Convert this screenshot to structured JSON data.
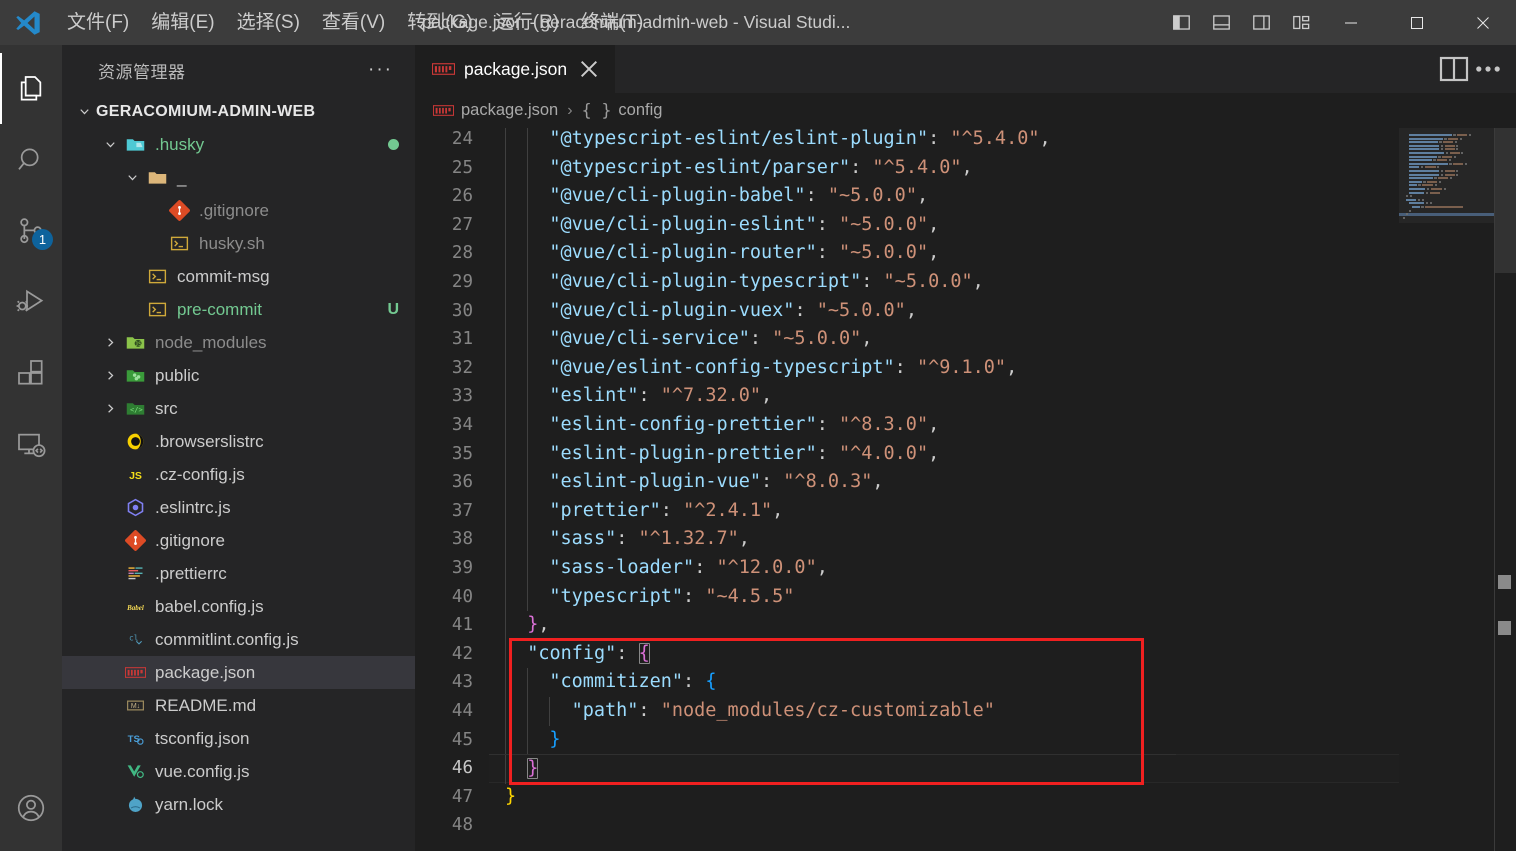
{
  "titlebar": {
    "logo_icon": "vscode-logo-icon",
    "menus": [
      {
        "label": "文件(F)",
        "name": "menu-file"
      },
      {
        "label": "编辑(E)",
        "name": "menu-edit"
      },
      {
        "label": "选择(S)",
        "name": "menu-selection"
      },
      {
        "label": "查看(V)",
        "name": "menu-view"
      },
      {
        "label": "转到(G)",
        "name": "menu-go"
      },
      {
        "label": "运行(R)",
        "name": "menu-run"
      },
      {
        "label": "终端(T)",
        "name": "menu-terminal"
      }
    ],
    "more_label": "···",
    "window_title": "package.json - geracomium-admin-web - Visual Studi...",
    "layout_buttons": [
      {
        "name": "toggle-primary-sidebar-icon"
      },
      {
        "name": "toggle-panel-icon"
      },
      {
        "name": "toggle-secondary-sidebar-icon"
      },
      {
        "name": "customize-layout-icon"
      }
    ],
    "window_buttons": [
      {
        "name": "minimize-button"
      },
      {
        "name": "maximize-button"
      },
      {
        "name": "close-button"
      }
    ]
  },
  "activitybar": {
    "items": [
      {
        "name": "activity-explorer",
        "icon": "files-icon",
        "active": true,
        "badge": ""
      },
      {
        "name": "activity-search",
        "icon": "search-icon",
        "active": false,
        "badge": ""
      },
      {
        "name": "activity-source-control",
        "icon": "source-control-icon",
        "active": false,
        "badge": "1"
      },
      {
        "name": "activity-run-and-debug",
        "icon": "run-debug-icon",
        "active": false,
        "badge": ""
      },
      {
        "name": "activity-extensions",
        "icon": "extensions-icon",
        "active": false,
        "badge": ""
      },
      {
        "name": "activity-remote-explorer",
        "icon": "remote-explorer-icon",
        "active": false,
        "badge": ""
      }
    ],
    "bottom": [
      {
        "name": "activity-accounts",
        "icon": "account-icon"
      }
    ]
  },
  "sidebar": {
    "title": "资源管理器",
    "actions_label": "···",
    "root": {
      "label": "GERACOMIUM-ADMIN-WEB",
      "expanded": true
    },
    "tree": [
      {
        "label": ".husky",
        "icon": "folder-husky-icon",
        "kind": "folder",
        "depth": 1,
        "expanded": true,
        "deco": "dot",
        "color": "green",
        "name": "tree-item-husky"
      },
      {
        "label": "_",
        "icon": "folder-icon",
        "kind": "folder",
        "depth": 2,
        "expanded": true,
        "deco": "",
        "color": "",
        "name": "tree-item-underscore"
      },
      {
        "label": ".gitignore",
        "icon": "git-icon",
        "kind": "file",
        "depth": 3,
        "expanded": null,
        "deco": "",
        "color": "dim",
        "name": "tree-item-husky-gitignore"
      },
      {
        "label": "husky.sh",
        "icon": "shell-icon",
        "kind": "file",
        "depth": 3,
        "expanded": null,
        "deco": "",
        "color": "dim",
        "name": "tree-item-husky-sh"
      },
      {
        "label": "commit-msg",
        "icon": "shell-icon",
        "kind": "file",
        "depth": 2,
        "expanded": null,
        "deco": "",
        "color": "",
        "name": "tree-item-commit-msg"
      },
      {
        "label": "pre-commit",
        "icon": "shell-icon",
        "kind": "file",
        "depth": 2,
        "expanded": null,
        "deco": "U",
        "color": "green",
        "name": "tree-item-pre-commit"
      },
      {
        "label": "node_modules",
        "icon": "folder-node-icon",
        "kind": "folder",
        "depth": 1,
        "expanded": false,
        "deco": "",
        "color": "dim",
        "name": "tree-item-node-modules"
      },
      {
        "label": "public",
        "icon": "folder-public-icon",
        "kind": "folder",
        "depth": 1,
        "expanded": false,
        "deco": "",
        "color": "",
        "name": "tree-item-public"
      },
      {
        "label": "src",
        "icon": "folder-src-icon",
        "kind": "folder",
        "depth": 1,
        "expanded": false,
        "deco": "",
        "color": "",
        "name": "tree-item-src"
      },
      {
        "label": ".browserslistrc",
        "icon": "browserslist-icon",
        "kind": "file",
        "depth": 1,
        "expanded": null,
        "deco": "",
        "color": "",
        "name": "tree-item-browserslistrc"
      },
      {
        "label": ".cz-config.js",
        "icon": "js-icon",
        "kind": "file",
        "depth": 1,
        "expanded": null,
        "deco": "",
        "color": "",
        "name": "tree-item-cz-config"
      },
      {
        "label": ".eslintrc.js",
        "icon": "eslint-icon",
        "kind": "file",
        "depth": 1,
        "expanded": null,
        "deco": "",
        "color": "",
        "name": "tree-item-eslintrc"
      },
      {
        "label": ".gitignore",
        "icon": "git-icon",
        "kind": "file",
        "depth": 1,
        "expanded": null,
        "deco": "",
        "color": "",
        "name": "tree-item-gitignore"
      },
      {
        "label": ".prettierrc",
        "icon": "prettier-icon",
        "kind": "file",
        "depth": 1,
        "expanded": null,
        "deco": "",
        "color": "",
        "name": "tree-item-prettierrc"
      },
      {
        "label": "babel.config.js",
        "icon": "babel-icon",
        "kind": "file",
        "depth": 1,
        "expanded": null,
        "deco": "",
        "color": "",
        "name": "tree-item-babel-config"
      },
      {
        "label": "commitlint.config.js",
        "icon": "commitlint-icon",
        "kind": "file",
        "depth": 1,
        "expanded": null,
        "deco": "",
        "color": "",
        "name": "tree-item-commitlint-config"
      },
      {
        "label": "package.json",
        "icon": "npm-icon",
        "kind": "file",
        "depth": 1,
        "expanded": null,
        "deco": "",
        "color": "",
        "name": "tree-item-package-json",
        "selected": true
      },
      {
        "label": "README.md",
        "icon": "markdown-icon",
        "kind": "file",
        "depth": 1,
        "expanded": null,
        "deco": "",
        "color": "",
        "name": "tree-item-readme"
      },
      {
        "label": "tsconfig.json",
        "icon": "tsconfig-icon",
        "kind": "file",
        "depth": 1,
        "expanded": null,
        "deco": "",
        "color": "",
        "name": "tree-item-tsconfig"
      },
      {
        "label": "vue.config.js",
        "icon": "vue-config-icon",
        "kind": "file",
        "depth": 1,
        "expanded": null,
        "deco": "",
        "color": "",
        "name": "tree-item-vue-config"
      },
      {
        "label": "yarn.lock",
        "icon": "yarn-icon",
        "kind": "file",
        "depth": 1,
        "expanded": null,
        "deco": "",
        "color": "",
        "name": "tree-item-yarn-lock"
      }
    ]
  },
  "editor": {
    "tabs": [
      {
        "label": "package.json",
        "icon": "npm-icon",
        "active": true,
        "close_icon": "close-icon"
      }
    ],
    "tab_actions": [
      {
        "name": "split-editor-right-icon"
      },
      {
        "name": "editor-more-actions-icon"
      }
    ],
    "breadcrumb": {
      "file_icon": "npm-icon",
      "file": "package.json",
      "separator": "›",
      "symbol_glyph": "{ }",
      "symbol": "config"
    },
    "first_line_number": 24,
    "current_line": 46,
    "colors": {
      "editor_bg": "#1e1e1e",
      "sidebar_bg": "#252526",
      "activitybar_bg": "#333333",
      "titlebar_bg": "#3c3c3c",
      "selection_bg": "#37373d",
      "annotation_red": "#f02020",
      "badge_blue": "#0e639c",
      "git_green": "#73c991"
    },
    "lines": [
      {
        "n": 24,
        "indent": 2,
        "tokens": [
          {
            "t": "\"@typescript-eslint/eslint-plugin\"",
            "c": "k"
          },
          {
            "t": ": ",
            "c": "p"
          },
          {
            "t": "\"^5.4.0\"",
            "c": "s"
          },
          {
            "t": ",",
            "c": "p"
          }
        ]
      },
      {
        "n": 25,
        "indent": 2,
        "tokens": [
          {
            "t": "\"@typescript-eslint/parser\"",
            "c": "k"
          },
          {
            "t": ": ",
            "c": "p"
          },
          {
            "t": "\"^5.4.0\"",
            "c": "s"
          },
          {
            "t": ",",
            "c": "p"
          }
        ]
      },
      {
        "n": 26,
        "indent": 2,
        "tokens": [
          {
            "t": "\"@vue/cli-plugin-babel\"",
            "c": "k"
          },
          {
            "t": ": ",
            "c": "p"
          },
          {
            "t": "\"~5.0.0\"",
            "c": "s"
          },
          {
            "t": ",",
            "c": "p"
          }
        ]
      },
      {
        "n": 27,
        "indent": 2,
        "tokens": [
          {
            "t": "\"@vue/cli-plugin-eslint\"",
            "c": "k"
          },
          {
            "t": ": ",
            "c": "p"
          },
          {
            "t": "\"~5.0.0\"",
            "c": "s"
          },
          {
            "t": ",",
            "c": "p"
          }
        ]
      },
      {
        "n": 28,
        "indent": 2,
        "tokens": [
          {
            "t": "\"@vue/cli-plugin-router\"",
            "c": "k"
          },
          {
            "t": ": ",
            "c": "p"
          },
          {
            "t": "\"~5.0.0\"",
            "c": "s"
          },
          {
            "t": ",",
            "c": "p"
          }
        ]
      },
      {
        "n": 29,
        "indent": 2,
        "tokens": [
          {
            "t": "\"@vue/cli-plugin-typescript\"",
            "c": "k"
          },
          {
            "t": ": ",
            "c": "p"
          },
          {
            "t": "\"~5.0.0\"",
            "c": "s"
          },
          {
            "t": ",",
            "c": "p"
          }
        ]
      },
      {
        "n": 30,
        "indent": 2,
        "tokens": [
          {
            "t": "\"@vue/cli-plugin-vuex\"",
            "c": "k"
          },
          {
            "t": ": ",
            "c": "p"
          },
          {
            "t": "\"~5.0.0\"",
            "c": "s"
          },
          {
            "t": ",",
            "c": "p"
          }
        ]
      },
      {
        "n": 31,
        "indent": 2,
        "tokens": [
          {
            "t": "\"@vue/cli-service\"",
            "c": "k"
          },
          {
            "t": ": ",
            "c": "p"
          },
          {
            "t": "\"~5.0.0\"",
            "c": "s"
          },
          {
            "t": ",",
            "c": "p"
          }
        ]
      },
      {
        "n": 32,
        "indent": 2,
        "tokens": [
          {
            "t": "\"@vue/eslint-config-typescript\"",
            "c": "k"
          },
          {
            "t": ": ",
            "c": "p"
          },
          {
            "t": "\"^9.1.0\"",
            "c": "s"
          },
          {
            "t": ",",
            "c": "p"
          }
        ]
      },
      {
        "n": 33,
        "indent": 2,
        "tokens": [
          {
            "t": "\"eslint\"",
            "c": "k"
          },
          {
            "t": ": ",
            "c": "p"
          },
          {
            "t": "\"^7.32.0\"",
            "c": "s"
          },
          {
            "t": ",",
            "c": "p"
          }
        ]
      },
      {
        "n": 34,
        "indent": 2,
        "tokens": [
          {
            "t": "\"eslint-config-prettier\"",
            "c": "k"
          },
          {
            "t": ": ",
            "c": "p"
          },
          {
            "t": "\"^8.3.0\"",
            "c": "s"
          },
          {
            "t": ",",
            "c": "p"
          }
        ]
      },
      {
        "n": 35,
        "indent": 2,
        "tokens": [
          {
            "t": "\"eslint-plugin-prettier\"",
            "c": "k"
          },
          {
            "t": ": ",
            "c": "p"
          },
          {
            "t": "\"^4.0.0\"",
            "c": "s"
          },
          {
            "t": ",",
            "c": "p"
          }
        ]
      },
      {
        "n": 36,
        "indent": 2,
        "tokens": [
          {
            "t": "\"eslint-plugin-vue\"",
            "c": "k"
          },
          {
            "t": ": ",
            "c": "p"
          },
          {
            "t": "\"^8.0.3\"",
            "c": "s"
          },
          {
            "t": ",",
            "c": "p"
          }
        ]
      },
      {
        "n": 37,
        "indent": 2,
        "tokens": [
          {
            "t": "\"prettier\"",
            "c": "k"
          },
          {
            "t": ": ",
            "c": "p"
          },
          {
            "t": "\"^2.4.1\"",
            "c": "s"
          },
          {
            "t": ",",
            "c": "p"
          }
        ]
      },
      {
        "n": 38,
        "indent": 2,
        "tokens": [
          {
            "t": "\"sass\"",
            "c": "k"
          },
          {
            "t": ": ",
            "c": "p"
          },
          {
            "t": "\"^1.32.7\"",
            "c": "s"
          },
          {
            "t": ",",
            "c": "p"
          }
        ]
      },
      {
        "n": 39,
        "indent": 2,
        "tokens": [
          {
            "t": "\"sass-loader\"",
            "c": "k"
          },
          {
            "t": ": ",
            "c": "p"
          },
          {
            "t": "\"^12.0.0\"",
            "c": "s"
          },
          {
            "t": ",",
            "c": "p"
          }
        ]
      },
      {
        "n": 40,
        "indent": 2,
        "tokens": [
          {
            "t": "\"typescript\"",
            "c": "k"
          },
          {
            "t": ": ",
            "c": "p"
          },
          {
            "t": "\"~4.5.5\"",
            "c": "s"
          }
        ]
      },
      {
        "n": 41,
        "indent": 1,
        "tokens": [
          {
            "t": "}",
            "c": "b2"
          },
          {
            "t": ",",
            "c": "p"
          }
        ]
      },
      {
        "n": 42,
        "indent": 1,
        "tokens": [
          {
            "t": "\"config\"",
            "c": "k"
          },
          {
            "t": ": ",
            "c": "p"
          },
          {
            "t": "{",
            "c": "b2 brk-box"
          }
        ]
      },
      {
        "n": 43,
        "indent": 2,
        "tokens": [
          {
            "t": "\"commitizen\"",
            "c": "k"
          },
          {
            "t": ": ",
            "c": "p"
          },
          {
            "t": "{",
            "c": "b3"
          }
        ]
      },
      {
        "n": 44,
        "indent": 3,
        "tokens": [
          {
            "t": "\"path\"",
            "c": "k"
          },
          {
            "t": ": ",
            "c": "p"
          },
          {
            "t": "\"node_modules/cz-customizable\"",
            "c": "s"
          }
        ]
      },
      {
        "n": 45,
        "indent": 2,
        "tokens": [
          {
            "t": "}",
            "c": "b3"
          }
        ]
      },
      {
        "n": 46,
        "indent": 1,
        "tokens": [
          {
            "t": "}",
            "c": "b2 brk-box"
          }
        ]
      },
      {
        "n": 47,
        "indent": 0,
        "tokens": [
          {
            "t": "}",
            "c": "b1"
          }
        ]
      },
      {
        "n": 48,
        "indent": 0,
        "tokens": []
      }
    ],
    "annotation": {
      "name": "red-highlight-rectangle",
      "color": "#f02020",
      "covers_lines": [
        42,
        46
      ]
    }
  }
}
